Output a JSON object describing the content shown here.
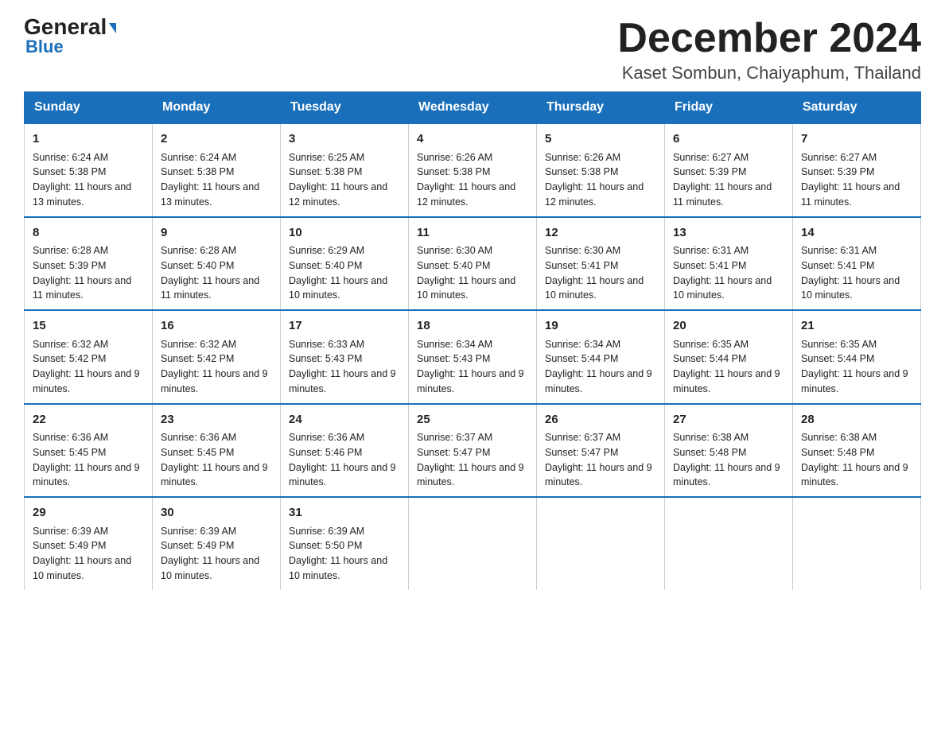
{
  "logo": {
    "line1_black": "General",
    "line1_blue": "Blue",
    "line2": "Blue"
  },
  "header": {
    "month_title": "December 2024",
    "subtitle": "Kaset Sombun, Chaiyaphum, Thailand"
  },
  "weekdays": [
    "Sunday",
    "Monday",
    "Tuesday",
    "Wednesday",
    "Thursday",
    "Friday",
    "Saturday"
  ],
  "weeks": [
    [
      {
        "day": "1",
        "sunrise": "6:24 AM",
        "sunset": "5:38 PM",
        "daylight": "11 hours and 13 minutes."
      },
      {
        "day": "2",
        "sunrise": "6:24 AM",
        "sunset": "5:38 PM",
        "daylight": "11 hours and 13 minutes."
      },
      {
        "day": "3",
        "sunrise": "6:25 AM",
        "sunset": "5:38 PM",
        "daylight": "11 hours and 12 minutes."
      },
      {
        "day": "4",
        "sunrise": "6:26 AM",
        "sunset": "5:38 PM",
        "daylight": "11 hours and 12 minutes."
      },
      {
        "day": "5",
        "sunrise": "6:26 AM",
        "sunset": "5:38 PM",
        "daylight": "11 hours and 12 minutes."
      },
      {
        "day": "6",
        "sunrise": "6:27 AM",
        "sunset": "5:39 PM",
        "daylight": "11 hours and 11 minutes."
      },
      {
        "day": "7",
        "sunrise": "6:27 AM",
        "sunset": "5:39 PM",
        "daylight": "11 hours and 11 minutes."
      }
    ],
    [
      {
        "day": "8",
        "sunrise": "6:28 AM",
        "sunset": "5:39 PM",
        "daylight": "11 hours and 11 minutes."
      },
      {
        "day": "9",
        "sunrise": "6:28 AM",
        "sunset": "5:40 PM",
        "daylight": "11 hours and 11 minutes."
      },
      {
        "day": "10",
        "sunrise": "6:29 AM",
        "sunset": "5:40 PM",
        "daylight": "11 hours and 10 minutes."
      },
      {
        "day": "11",
        "sunrise": "6:30 AM",
        "sunset": "5:40 PM",
        "daylight": "11 hours and 10 minutes."
      },
      {
        "day": "12",
        "sunrise": "6:30 AM",
        "sunset": "5:41 PM",
        "daylight": "11 hours and 10 minutes."
      },
      {
        "day": "13",
        "sunrise": "6:31 AM",
        "sunset": "5:41 PM",
        "daylight": "11 hours and 10 minutes."
      },
      {
        "day": "14",
        "sunrise": "6:31 AM",
        "sunset": "5:41 PM",
        "daylight": "11 hours and 10 minutes."
      }
    ],
    [
      {
        "day": "15",
        "sunrise": "6:32 AM",
        "sunset": "5:42 PM",
        "daylight": "11 hours and 9 minutes."
      },
      {
        "day": "16",
        "sunrise": "6:32 AM",
        "sunset": "5:42 PM",
        "daylight": "11 hours and 9 minutes."
      },
      {
        "day": "17",
        "sunrise": "6:33 AM",
        "sunset": "5:43 PM",
        "daylight": "11 hours and 9 minutes."
      },
      {
        "day": "18",
        "sunrise": "6:34 AM",
        "sunset": "5:43 PM",
        "daylight": "11 hours and 9 minutes."
      },
      {
        "day": "19",
        "sunrise": "6:34 AM",
        "sunset": "5:44 PM",
        "daylight": "11 hours and 9 minutes."
      },
      {
        "day": "20",
        "sunrise": "6:35 AM",
        "sunset": "5:44 PM",
        "daylight": "11 hours and 9 minutes."
      },
      {
        "day": "21",
        "sunrise": "6:35 AM",
        "sunset": "5:44 PM",
        "daylight": "11 hours and 9 minutes."
      }
    ],
    [
      {
        "day": "22",
        "sunrise": "6:36 AM",
        "sunset": "5:45 PM",
        "daylight": "11 hours and 9 minutes."
      },
      {
        "day": "23",
        "sunrise": "6:36 AM",
        "sunset": "5:45 PM",
        "daylight": "11 hours and 9 minutes."
      },
      {
        "day": "24",
        "sunrise": "6:36 AM",
        "sunset": "5:46 PM",
        "daylight": "11 hours and 9 minutes."
      },
      {
        "day": "25",
        "sunrise": "6:37 AM",
        "sunset": "5:47 PM",
        "daylight": "11 hours and 9 minutes."
      },
      {
        "day": "26",
        "sunrise": "6:37 AM",
        "sunset": "5:47 PM",
        "daylight": "11 hours and 9 minutes."
      },
      {
        "day": "27",
        "sunrise": "6:38 AM",
        "sunset": "5:48 PM",
        "daylight": "11 hours and 9 minutes."
      },
      {
        "day": "28",
        "sunrise": "6:38 AM",
        "sunset": "5:48 PM",
        "daylight": "11 hours and 9 minutes."
      }
    ],
    [
      {
        "day": "29",
        "sunrise": "6:39 AM",
        "sunset": "5:49 PM",
        "daylight": "11 hours and 10 minutes."
      },
      {
        "day": "30",
        "sunrise": "6:39 AM",
        "sunset": "5:49 PM",
        "daylight": "11 hours and 10 minutes."
      },
      {
        "day": "31",
        "sunrise": "6:39 AM",
        "sunset": "5:50 PM",
        "daylight": "11 hours and 10 minutes."
      },
      null,
      null,
      null,
      null
    ]
  ]
}
